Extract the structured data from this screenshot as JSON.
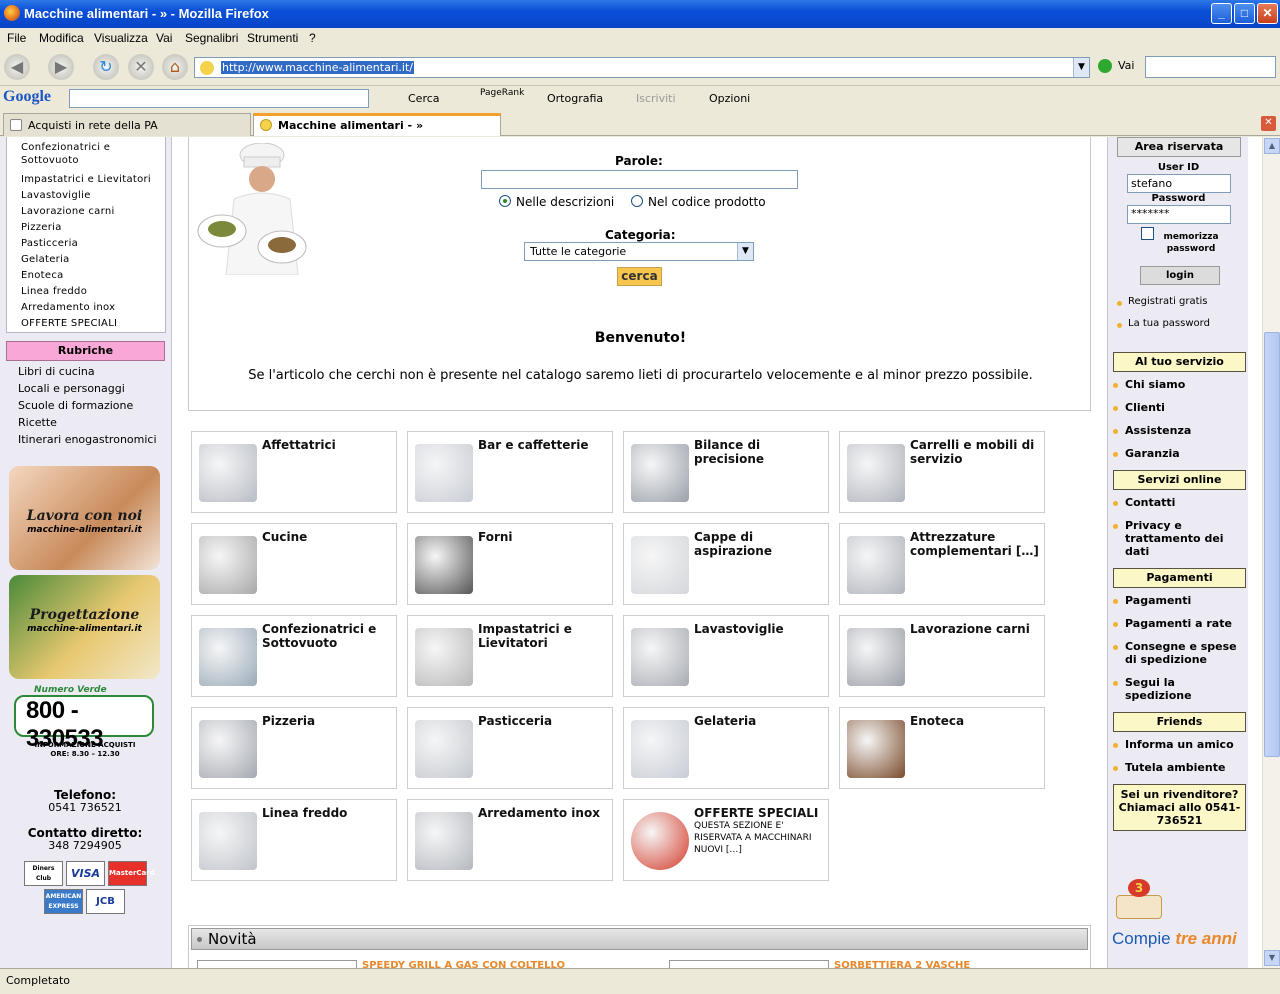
{
  "window": {
    "title": "Macchine alimentari - » - Mozilla Firefox",
    "min": "_",
    "max": "□",
    "close": "✕"
  },
  "menu": [
    "File",
    "Modifica",
    "Visualizza",
    "Vai",
    "Segnalibri",
    "Strumenti",
    "?"
  ],
  "nav": {
    "url": "http://www.macchine-alimentari.it/",
    "go_label": "Vai",
    "search_placeholder": ""
  },
  "google_bar": {
    "logo": "Google",
    "cerca": "Cerca",
    "pagerank": "PageRank",
    "ortografia": "Ortografia",
    "iscriviti": "Iscriviti",
    "opzioni": "Opzioni"
  },
  "tabs": [
    {
      "label": "Acquisti in rete della PA"
    },
    {
      "label": "Macchine alimentari - »"
    }
  ],
  "left": {
    "categories": [
      "Confezionatrici e",
      "Sottovuoto",
      "Impastatrici e Lievitatori",
      "Lavastoviglie",
      "Lavorazione carni",
      "Pizzeria",
      "Pasticceria",
      "Gelateria",
      "Enoteca",
      "Linea freddo",
      "Arredamento inox",
      "OFFERTE SPECIALI"
    ],
    "rubriche_title": "Rubriche",
    "rubriche": [
      "Libri di cucina",
      "Locali e personaggi",
      "Scuole di formazione",
      "Ricette",
      "Itinerari enogastronomici"
    ],
    "banner1": {
      "title": "Lavora con noi",
      "sub": "macchine-alimentari.it"
    },
    "banner2": {
      "title": "Progettazione",
      "sub": "macchine-alimentari.it"
    },
    "numero_verde": {
      "label": "Numero Verde",
      "number": "800 - 330533",
      "info1": "INFORMAZIONE ACQUISTI",
      "info2": "ORE: 8.30 – 12.30"
    },
    "telefono_label": "Telefono:",
    "telefono": "0541 736521",
    "contatto_label": "Contatto diretto:",
    "contatto": "348 7294905",
    "cards": [
      "Diners Club",
      "VISA",
      "MasterCard",
      "AMERICAN EXPRESS",
      "JCB"
    ]
  },
  "search": {
    "parole_label": "Parole:",
    "radio1": "Nelle descrizioni",
    "radio2": "Nel codice prodotto",
    "categoria_label": "Categoria:",
    "categoria_value": "Tutte le categorie",
    "button": "cerca"
  },
  "welcome": {
    "title": "Benvenuto!",
    "message": "Se l'articolo che cerchi non è presente nel catalogo saremo lieti di procurartelo velocemente e al minor prezzo possibile."
  },
  "products": [
    {
      "title": "Affettatrici",
      "desc": "",
      "color": "#b8bcc4"
    },
    {
      "title": "Bar e caffetterie",
      "desc": "",
      "color": "#c8ccd4"
    },
    {
      "title": "Bilance di precisione",
      "desc": "",
      "color": "#9aa0aa"
    },
    {
      "title": "Carrelli e mobili di servizio",
      "desc": "",
      "color": "#b0b4bc"
    },
    {
      "title": "Cucine",
      "desc": "",
      "color": "#a8a8a8"
    },
    {
      "title": "Forni",
      "desc": "",
      "color": "#555555"
    },
    {
      "title": "Cappe di aspirazione",
      "desc": "",
      "color": "#d4d6da"
    },
    {
      "title": "Attrezzature complementari […]",
      "desc": "",
      "color": "#b0b4bc"
    },
    {
      "title": "Confezionatrici e Sottovuoto",
      "desc": "",
      "color": "#9aaab8"
    },
    {
      "title": "Impastatrici e Lievitatori",
      "desc": "",
      "color": "#b8b8b8"
    },
    {
      "title": "Lavastoviglie",
      "desc": "",
      "color": "#a8acb2"
    },
    {
      "title": "Lavorazione carni",
      "desc": "",
      "color": "#9ca0a8"
    },
    {
      "title": "Pizzeria",
      "desc": "",
      "color": "#a4a8b0"
    },
    {
      "title": "Pasticceria",
      "desc": "",
      "color": "#c4c8ce"
    },
    {
      "title": "Gelateria",
      "desc": "",
      "color": "#c8ccd6"
    },
    {
      "title": "Enoteca",
      "desc": "",
      "color": "#7a4a2a"
    },
    {
      "title": "Linea freddo",
      "desc": "",
      "color": "#c0c4ca"
    },
    {
      "title": "Arredamento inox",
      "desc": "",
      "color": "#b4b8be"
    },
    {
      "title": "OFFERTE SPECIALI",
      "desc": "QUESTA SEZIONE E' RISERVATA A MACCHINARI NUOVI […]",
      "color": "#d43a2a"
    }
  ],
  "novita": {
    "title": "Novità",
    "item1": "SPEEDY GRILL A GAS CON COLTELLO",
    "item2": "SORBETTIERA 2 VASCHE"
  },
  "right": {
    "area_title": "Area riservata",
    "userid_label": "User ID",
    "userid": "stefano",
    "password_label": "Password",
    "password": "*******",
    "memorizza": "memorizza password",
    "login": "login",
    "registrati": "Registrati gratis",
    "tua_password": "La tua password",
    "servizio_title": "Al tuo servizio",
    "servizio": [
      "Chi siamo",
      "Clienti",
      "Assistenza",
      "Garanzia"
    ],
    "online_title": "Servizi online",
    "online": [
      "Contatti",
      "Privacy e trattamento dei dati"
    ],
    "pagamenti_title": "Pagamenti",
    "pagamenti": [
      "Pagamenti",
      "Pagamenti a rate",
      "Consegne e spese di spedizione",
      "Segui la spedizione"
    ],
    "friends_title": "Friends",
    "friends": [
      "Informa un amico",
      "Tutela ambiente"
    ],
    "rivenditore": "Sei un rivenditore? Chiamaci allo 0541-736521",
    "compie": "Compie",
    "tre_anni": "tre anni",
    "candle": "3"
  },
  "status": "Completato",
  "colors": {
    "titlebar": "#0a4ed8",
    "rubriche": "#f8a7d6",
    "right_header": "#fbf7c7",
    "button": "#f7c64f",
    "accent": "#e8882a"
  }
}
